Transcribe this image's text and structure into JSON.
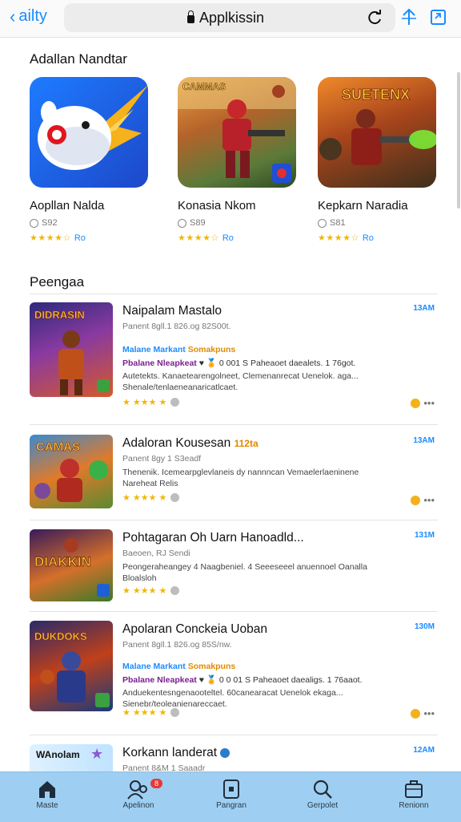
{
  "browser": {
    "back_label": "ailty",
    "url": "Applkissin"
  },
  "featured": {
    "title": "Adallan Nandtar",
    "items": [
      {
        "title": "Aopllan Nalda",
        "count": "S92",
        "rating": "Ro"
      },
      {
        "title": "Konasia Nkom",
        "count": "S89",
        "rating": "Ro"
      },
      {
        "title": "Kepkarn Naradia",
        "count": "S81",
        "rating": "Ro"
      }
    ],
    "thumb_texts": [
      "CAMMAS",
      "SUETENX"
    ]
  },
  "list": {
    "title": "Peengaa",
    "items": [
      {
        "title": "Naipalam Mastalo",
        "time": "13AM",
        "sub": "Panent 8gll.1 826.og 82S00t.",
        "tag1_blue": "Malane Markant",
        "tag1_orange": "Somakpuns",
        "tag2_purple": "Pbalane Nleapkeat",
        "tag2_rest": "♥ 🏅 0 001 S Paheaoet daealets. 1 76got.",
        "desc": "Autetekts. Kanaetearengolneet, Clemenanrecat Uenelok. aga... Shenale/tenlaeneanaricatlcaet.",
        "thumb": "DIDRASIN"
      },
      {
        "title": "Adaloran Kousesan",
        "title_tag": "112ta",
        "time": "13AM",
        "sub": "Panent 8gy 1 S3eadf",
        "desc": "Thenenik. Icemearpglevlaneis dy nannncan Vemaelerlaeninene Nareheat Relis",
        "thumb": "CAMAS"
      },
      {
        "title": "Pohtagaran Oh Uarn Hanoadld...",
        "time": "131M",
        "sub": "Baeoen, RJ Sendi",
        "desc": "Peongeraheangey 4 Naagbeniel. 4 Seeeseeel anuennoel Oanalla Bloalsloh",
        "thumb": "DIAKKIN"
      },
      {
        "title": "Apolaran Conckeia Uoban",
        "time": "130M",
        "sub": "Panent 8gll.1 826.og 85S/nw.",
        "tag1_blue": "Malane Markant",
        "tag1_orange": "Somakpuns",
        "tag2_purple": "Pbalane Nleapkeat",
        "tag2_rest": "♥ 🏅 0 0 01 S Paheaoet daealigs. 1 76aaot.",
        "desc": "Anduekentesngenaooteltel. 60canearacat Uenelok ekaga... Sienebr/teoleanienareccaet.",
        "thumb": "DUKDOKS"
      },
      {
        "title": "Korkann landerat",
        "time": "12AM",
        "sub": "Panent 8&M 1 Saaadr",
        "thumb": "WAnolam"
      }
    ]
  },
  "tabbar": {
    "items": [
      {
        "label": "Maste"
      },
      {
        "label": "Apelinon",
        "badge": "8"
      },
      {
        "label": "Pangran"
      },
      {
        "label": "Gerpolet"
      },
      {
        "label": "Renionn"
      }
    ]
  },
  "colors": {
    "accent": "#1a8cff",
    "tabbar": "#9ecff2",
    "star": "#f2b705"
  }
}
